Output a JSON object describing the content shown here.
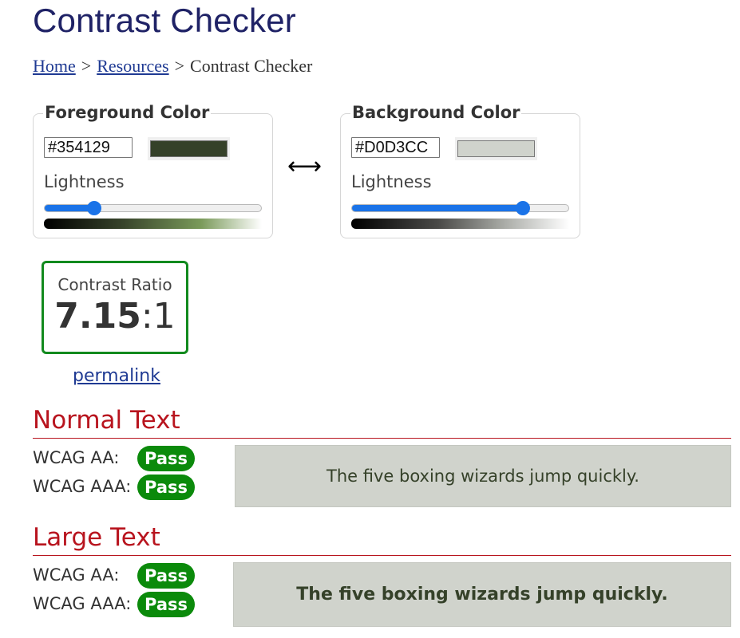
{
  "page": {
    "title": "Contrast Checker"
  },
  "breadcrumb": {
    "home": "Home",
    "resources": "Resources",
    "current": "Contrast Checker",
    "separator": ">"
  },
  "foreground": {
    "legend": "Foreground Color",
    "hex": "#354129",
    "swatch_color": "#354129",
    "lightness_label": "Lightness",
    "lightness_fraction": 0.23
  },
  "background": {
    "legend": "Background Color",
    "hex": "#D0D3CC",
    "swatch_color": "#D0D3CC",
    "lightness_label": "Lightness",
    "lightness_fraction": 0.79
  },
  "swap": {
    "icon": "left-right-arrow-icon",
    "glyph": "⟷"
  },
  "result": {
    "label": "Contrast Ratio",
    "ratio": "7.15",
    "ratio_suffix": ":1",
    "permalink": "permalink",
    "accent_color": "#128a1e"
  },
  "normal_text": {
    "title": "Normal Text",
    "aa_label": "WCAG AA:",
    "aa_result": "Pass",
    "aaa_label": "WCAG AAA:",
    "aaa_result": "Pass",
    "sample": "The five boxing wizards jump quickly."
  },
  "large_text": {
    "title": "Large Text",
    "aa_label": "WCAG AA:",
    "aa_result": "Pass",
    "aaa_label": "WCAG AAA:",
    "aaa_result": "Pass",
    "sample": "The five boxing wizards jump quickly."
  },
  "colors": {
    "title": "#1f2266",
    "section_heading": "#b8141e",
    "pass_badge": "#0b8a0b",
    "link": "#1f3a93",
    "slider": "#1a73e8"
  }
}
